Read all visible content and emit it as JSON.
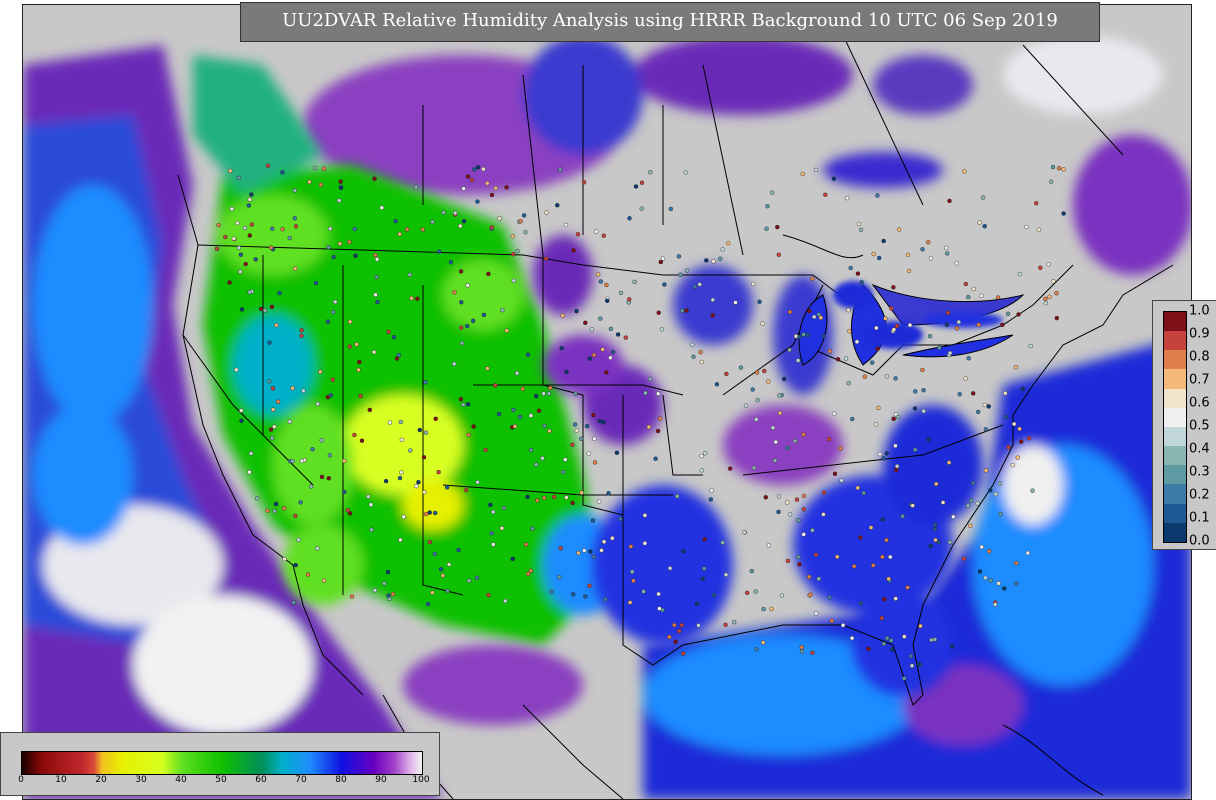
{
  "title": "UU2DVAR Relative Humidity Analysis using HRRR Background 10 UTC 06 Sep 2019",
  "obs_colorbar": {
    "ticks": [
      "0.0",
      "0.1",
      "0.2",
      "0.3",
      "0.4",
      "0.5",
      "0.6",
      "0.7",
      "0.8",
      "0.9",
      "1.0"
    ],
    "colors": [
      "#0b3a6e",
      "#1f5a94",
      "#3d7aa8",
      "#5e9aa2",
      "#8ab6b2",
      "#c1d6d8",
      "#eef0f2",
      "#f1e4cc",
      "#f3b978",
      "#e07e4c",
      "#c6423c",
      "#7d1019"
    ]
  },
  "rh_colorbar": {
    "ticks": [
      "0",
      "10",
      "20",
      "30",
      "40",
      "50",
      "60",
      "70",
      "80",
      "90",
      "100"
    ],
    "stops": [
      {
        "v": 0,
        "c": "#1a0000"
      },
      {
        "v": 5,
        "c": "#8b0a0a"
      },
      {
        "v": 15,
        "c": "#c0272d"
      },
      {
        "v": 18,
        "c": "#d94a3a"
      },
      {
        "v": 20,
        "c": "#f0c020"
      },
      {
        "v": 25,
        "c": "#e6f000"
      },
      {
        "v": 35,
        "c": "#d8ff20"
      },
      {
        "v": 40,
        "c": "#60e020"
      },
      {
        "v": 50,
        "c": "#10c000"
      },
      {
        "v": 60,
        "c": "#008f5a"
      },
      {
        "v": 65,
        "c": "#00b0c8"
      },
      {
        "v": 72,
        "c": "#1e8cff"
      },
      {
        "v": 80,
        "c": "#1010e0"
      },
      {
        "v": 88,
        "c": "#6a00c0"
      },
      {
        "v": 93,
        "c": "#a040c8"
      },
      {
        "v": 97,
        "c": "#e0b0e8"
      },
      {
        "v": 100,
        "c": "#f2f2f2"
      }
    ]
  }
}
